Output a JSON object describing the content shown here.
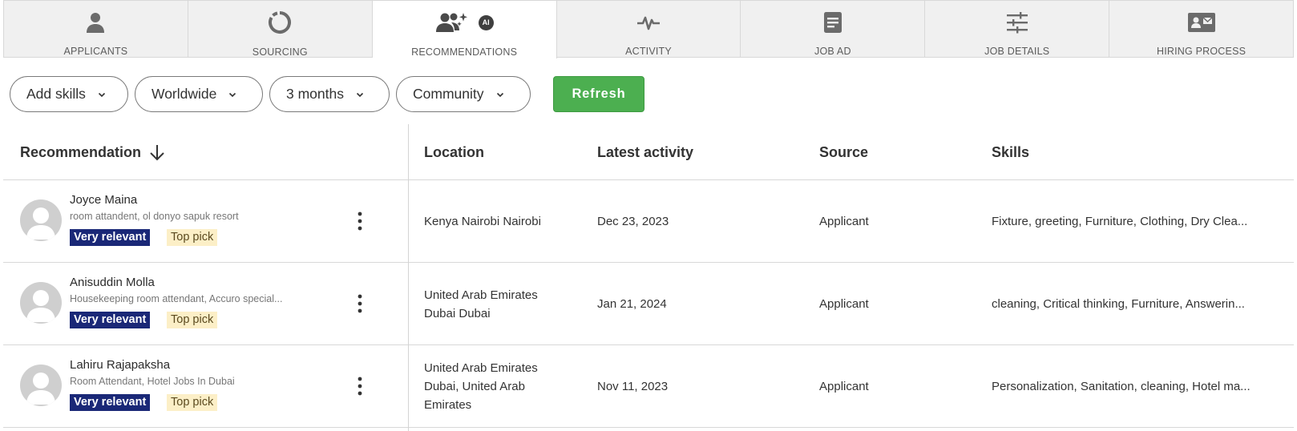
{
  "tabs": [
    {
      "label": "APPLICANTS",
      "icon": "person-icon",
      "active": false
    },
    {
      "label": "SOURCING",
      "icon": "sourcing-circle-icon",
      "active": false
    },
    {
      "label": "RECOMMENDATIONS",
      "icon": "people-sparkle-icon",
      "active": true,
      "badge": "AI"
    },
    {
      "label": "ACTIVITY",
      "icon": "pulse-icon",
      "active": false
    },
    {
      "label": "JOB AD",
      "icon": "document-icon",
      "active": false
    },
    {
      "label": "JOB DETAILS",
      "icon": "sliders-icon",
      "active": false
    },
    {
      "label": "HIRING PROCESS",
      "icon": "id-card-icon",
      "active": false
    }
  ],
  "filters": {
    "skills": "Add skills",
    "location": "Worldwide",
    "period": "3 months",
    "pool": "Community",
    "refresh": "Refresh"
  },
  "table": {
    "headers": {
      "recommendation": "Recommendation",
      "location": "Location",
      "latest_activity": "Latest activity",
      "source": "Source",
      "skills": "Skills"
    },
    "rows": [
      {
        "name": "Joyce Maina",
        "subtitle": "room attandent, ol donyo sapuk resort",
        "relevance": "Very relevant",
        "pick": "Top pick",
        "location": "Kenya Nairobi Nairobi",
        "latest_activity": "Dec 23, 2023",
        "source": "Applicant",
        "skills": "Fixture, greeting, Furniture, Clothing, Dry Clea..."
      },
      {
        "name": "Anisuddin Molla",
        "subtitle": "Housekeeping room attendant, Accuro special...",
        "relevance": "Very relevant",
        "pick": "Top pick",
        "location": "United Arab Emirates Dubai Dubai",
        "latest_activity": "Jan 21, 2024",
        "source": "Applicant",
        "skills": "cleaning, Critical thinking, Furniture, Answerin..."
      },
      {
        "name": "Lahiru Rajapaksha",
        "subtitle": "Room Attendant, Hotel Jobs In Dubai",
        "relevance": "Very relevant",
        "pick": "Top pick",
        "location": "United Arab Emirates Dubai, United Arab Emirates",
        "latest_activity": "Nov 11, 2023",
        "source": "Applicant",
        "skills": "Personalization, Sanitation, cleaning, Hotel ma..."
      }
    ]
  },
  "colors": {
    "refresh_green": "#4caf50",
    "relevance_badge": "#1a2877",
    "top_pick_badge": "#fcefc7",
    "tab_inactive_bg": "#f0f0f0"
  }
}
